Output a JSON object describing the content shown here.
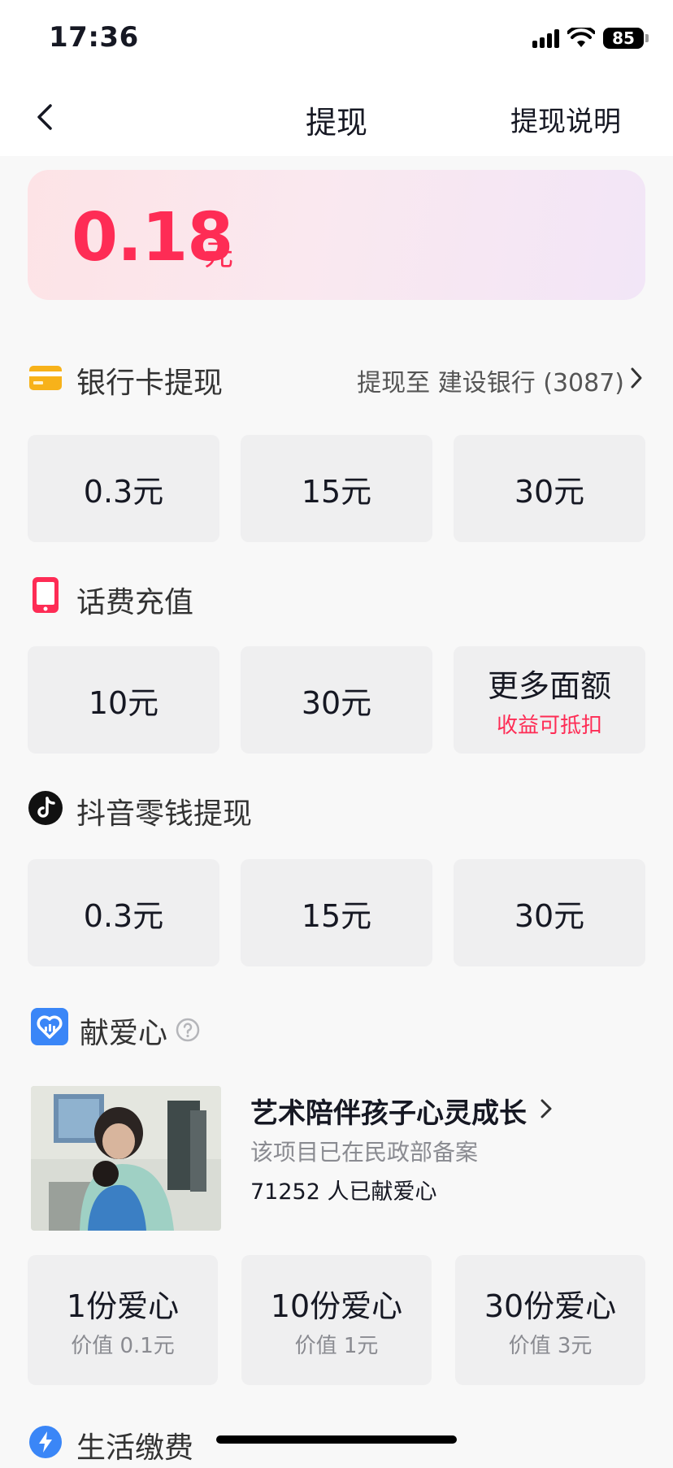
{
  "status_bar": {
    "time": "17:36",
    "battery": "85"
  },
  "nav": {
    "title": "提现",
    "right_link": "提现说明"
  },
  "balance": {
    "amount": "0.18",
    "unit": "元"
  },
  "bank_section": {
    "title": "银行卡提现",
    "link": "提现至 建设银行 (3087)",
    "options": [
      {
        "label": "0.3元"
      },
      {
        "label": "15元"
      },
      {
        "label": "30元"
      }
    ]
  },
  "phone_section": {
    "title": "话费充值",
    "options": [
      {
        "label": "10元"
      },
      {
        "label": "30元"
      },
      {
        "label": "更多面额",
        "sub": "收益可抵扣"
      }
    ]
  },
  "douyin_section": {
    "title": "抖音零钱提现",
    "options": [
      {
        "label": "0.3元"
      },
      {
        "label": "15元"
      },
      {
        "label": "30元"
      }
    ]
  },
  "charity_section": {
    "title": "献爱心",
    "project": {
      "title": "艺术陪伴孩子心灵成长",
      "note": "该项目已在民政部备案",
      "count": "71252 人已献爱心"
    },
    "options": [
      {
        "label": "1份爱心",
        "sub": "价值 0.1元"
      },
      {
        "label": "10份爱心",
        "sub": "价值 1元"
      },
      {
        "label": "30份爱心",
        "sub": "价值 3元"
      }
    ]
  },
  "life_section": {
    "title": "生活缴费"
  },
  "colors": {
    "accent": "#fe2c55",
    "bank_icon": "#f7b21a",
    "charity_icon": "#3a86f7"
  }
}
